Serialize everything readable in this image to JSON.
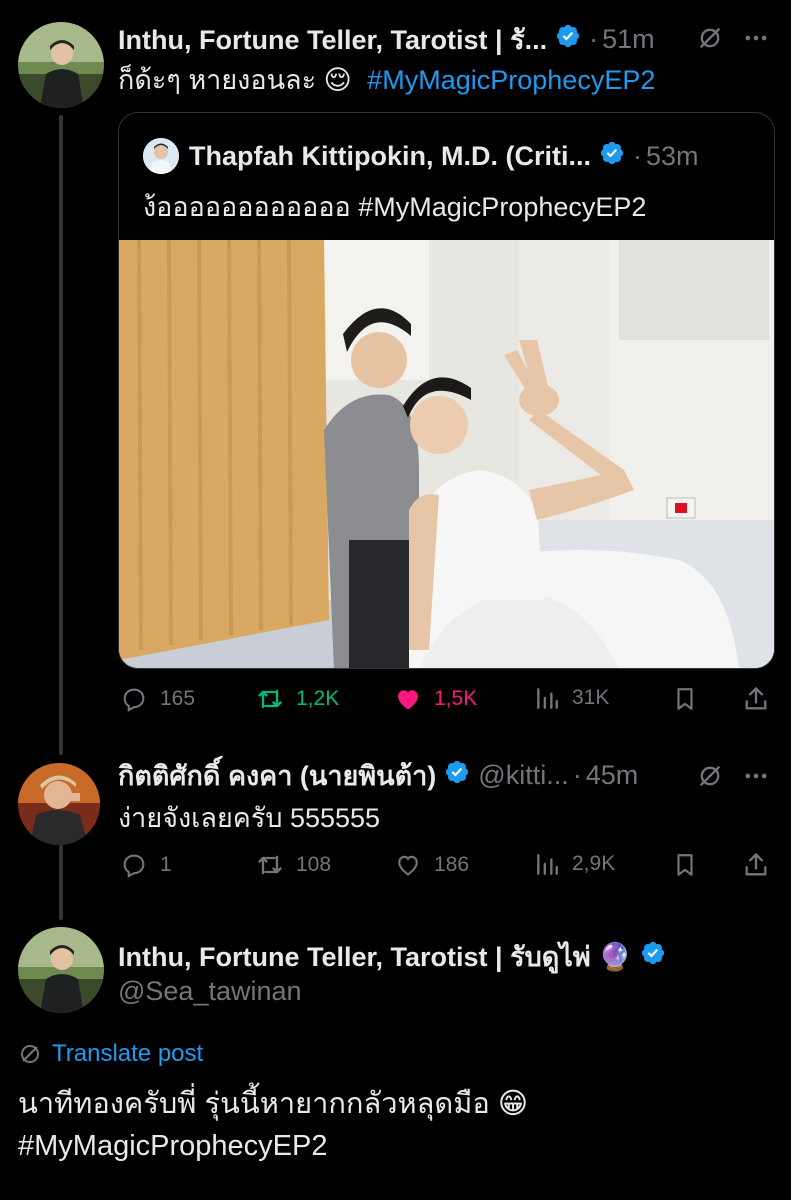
{
  "colors": {
    "background": "#000000",
    "text": "#e7e9ea",
    "muted": "#71767b",
    "link": "#1d9bf0",
    "verified": "#1d9bf0",
    "retweet_active": "#00ba7c",
    "like_active": "#f91880",
    "border": "#2f3336"
  },
  "tweet1": {
    "author": "Inthu, Fortune Teller, Tarotist | รั...",
    "dot": "·",
    "time": "51m",
    "text_plain": "ก็ด้ะๆ หายงอนละ 😌",
    "hashtag": "#MyMagicProphecyEP2",
    "icons": [
      "verified-icon",
      "grok-icon"
    ]
  },
  "quote": {
    "author": "Thapfah Kittipokin, M.D. (Criti...",
    "dot": "·",
    "time": "53m",
    "text": "ง้ออออออออออออ #MyMagicProphecyEP2",
    "photo_alt": "Two men in a hospital room, one in bed making a peace sign"
  },
  "tweet1_actions": {
    "replies": "165",
    "reposts": "1,2K",
    "likes": "1,5K",
    "views": "31K"
  },
  "tweet2": {
    "author": "กิตติศักดิ์ คงคา (นายพินต้า)",
    "handle": "@kitti...",
    "dot": "·",
    "time": "45m",
    "text": "ง่ายจังเลยครับ 555555",
    "actions": {
      "replies": "1",
      "reposts": "108",
      "likes": "186",
      "views": "2,9K"
    }
  },
  "tweet3": {
    "author": "Inthu, Fortune Teller, Tarotist | รับดูไพ่ 🔮",
    "handle": "@Sea_tawinan",
    "translate": "Translate post",
    "text_line1": "นาทีทองครับพี่ รุ่นนี้หายากกลัวหลุดมือ 😁",
    "hashtag": "#MyMagicProphecyEP2"
  }
}
